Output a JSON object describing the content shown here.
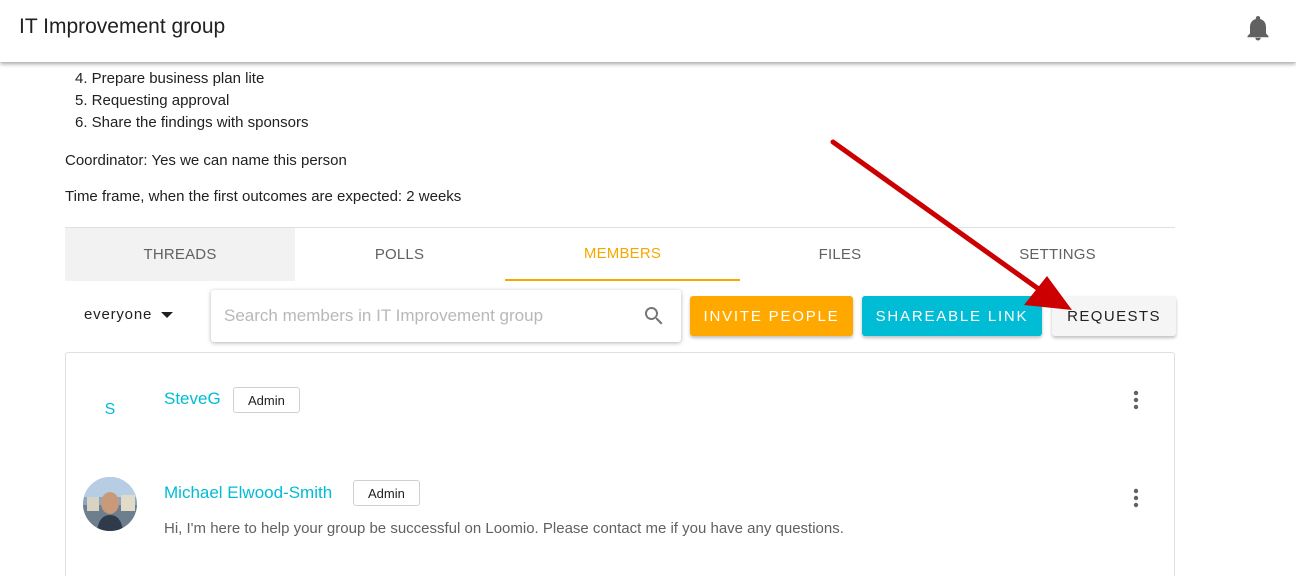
{
  "header": {
    "title": "IT Improvement group",
    "notifications_icon": "bell-icon"
  },
  "description": {
    "steps": [
      "4. Prepare business plan lite",
      "5. Requesting approval",
      "6. Share the findings with sponsors"
    ],
    "coordinator": "Coordinator: Yes we can name this person",
    "time_frame": "Time frame, when the first outcomes are expected: 2 weeks"
  },
  "tabs": [
    {
      "label": "THREADS"
    },
    {
      "label": "POLLS"
    },
    {
      "label": "MEMBERS",
      "active": true
    },
    {
      "label": "FILES"
    },
    {
      "label": "SETTINGS"
    }
  ],
  "toolbar": {
    "filter_label": "everyone",
    "search_placeholder": "Search members in IT Improvement group",
    "invite_label": "INVITE PEOPLE",
    "share_label": "SHAREABLE LINK",
    "requests_label": "REQUESTS"
  },
  "members": [
    {
      "initials": "S",
      "name": "SteveG",
      "role": "Admin",
      "bio": ""
    },
    {
      "name": "Michael Elwood-Smith",
      "role": "Admin",
      "bio": "Hi, I'm here to help your group be successful on Loomio. Please contact me if you have any questions."
    }
  ],
  "colors": {
    "accent": "#ffa900",
    "primary": "#00bcd4",
    "annotation_arrow": "#cc0000"
  }
}
